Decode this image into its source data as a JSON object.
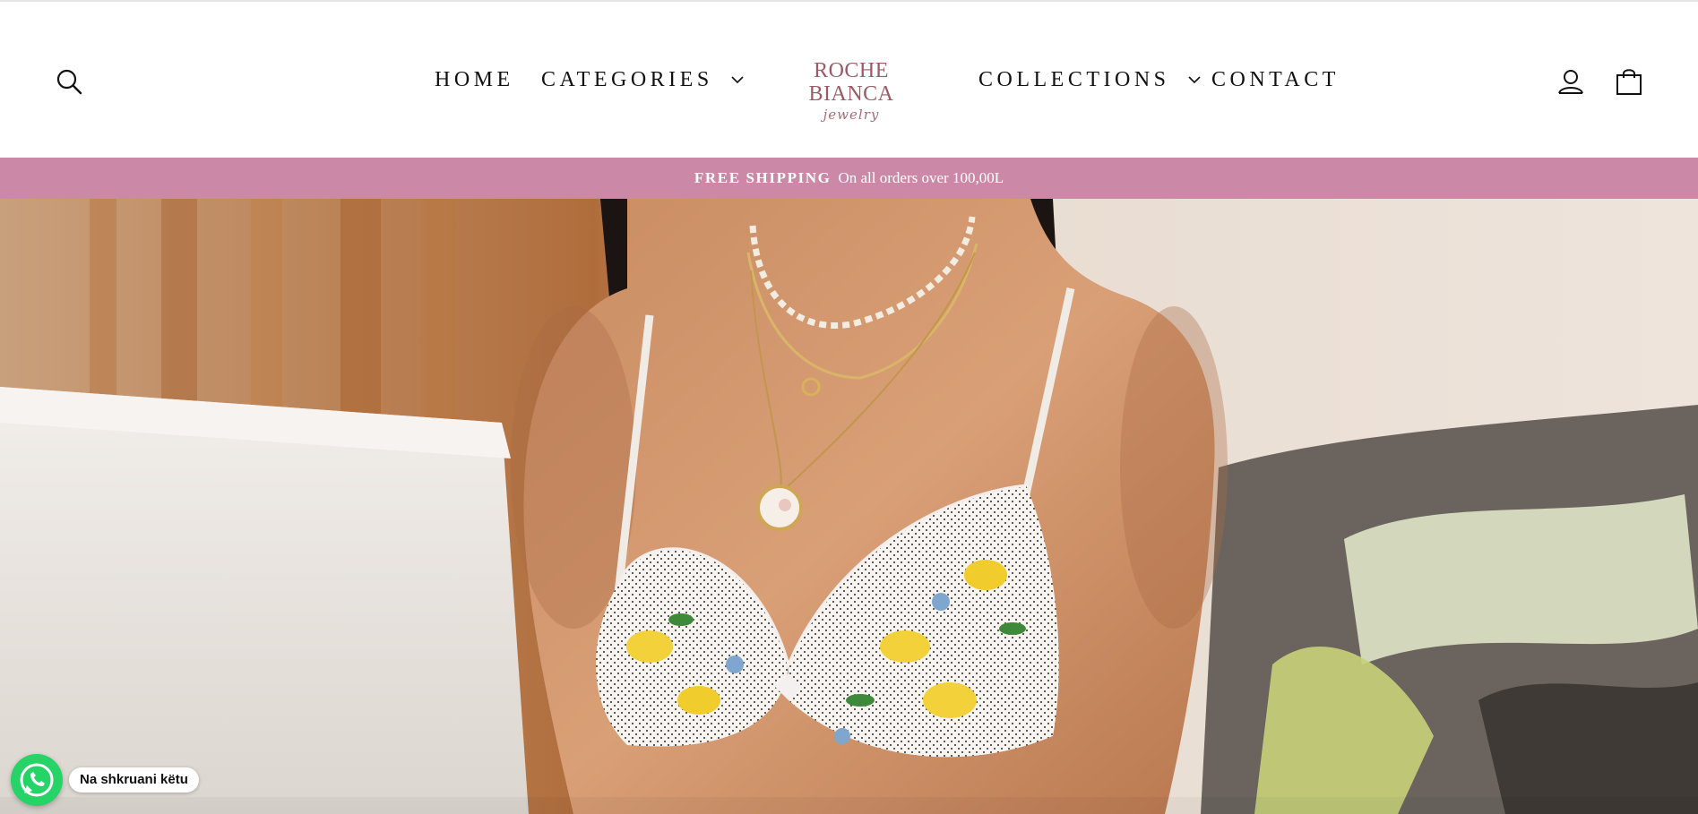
{
  "header": {
    "nav": {
      "home": "HOME",
      "categories": "CATEGORIES",
      "collections": "COLLECTIONS",
      "contact": "CONTACT"
    },
    "logo": {
      "name": "ROCHE BIANCA",
      "tagline": "jewelry"
    },
    "icons": {
      "search": "search-icon",
      "account": "user-icon",
      "cart": "shopping-bag-icon"
    }
  },
  "announcement": {
    "highlight": "FREE SHIPPING",
    "text": "On all orders over 100,00L",
    "background_color": "#cc88a7"
  },
  "hero": {
    "alt_subject": "model-wearing-pearl-necklaces-and-lemon-print-bikini"
  },
  "whatsapp": {
    "label": "Na shkruani këtu",
    "color": "#25d366"
  }
}
